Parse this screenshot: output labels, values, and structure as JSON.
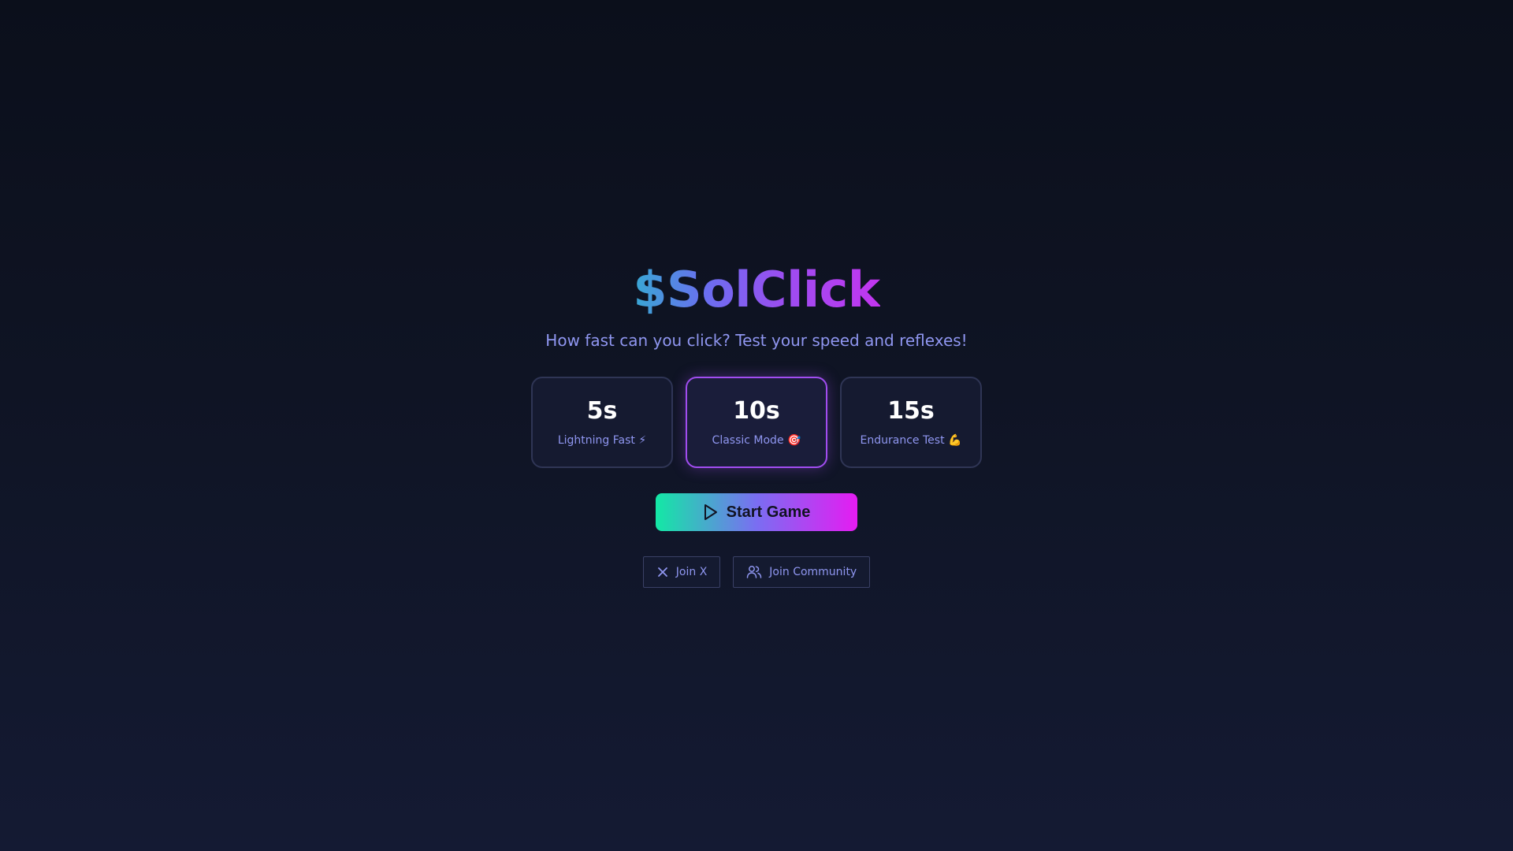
{
  "app": {
    "title": "$SolClick",
    "subtitle": "How fast can you click? Test your speed and reflexes!"
  },
  "modes": [
    {
      "time": "5s",
      "label": "Lightning Fast ⚡",
      "selected": false
    },
    {
      "time": "10s",
      "label": "Classic Mode 🎯",
      "selected": true
    },
    {
      "time": "15s",
      "label": "Endurance Test 💪",
      "selected": false
    }
  ],
  "start_button": {
    "label": "Start Game",
    "icon": "play-icon"
  },
  "socials": [
    {
      "label": "Join X",
      "icon": "x-icon"
    },
    {
      "label": "Join Community",
      "icon": "users-icon"
    }
  ],
  "colors": {
    "accent": "#a14df0",
    "muted_text": "#8f96f0",
    "gradient_start": "#13e8a5",
    "gradient_end": "#e51cf2"
  }
}
